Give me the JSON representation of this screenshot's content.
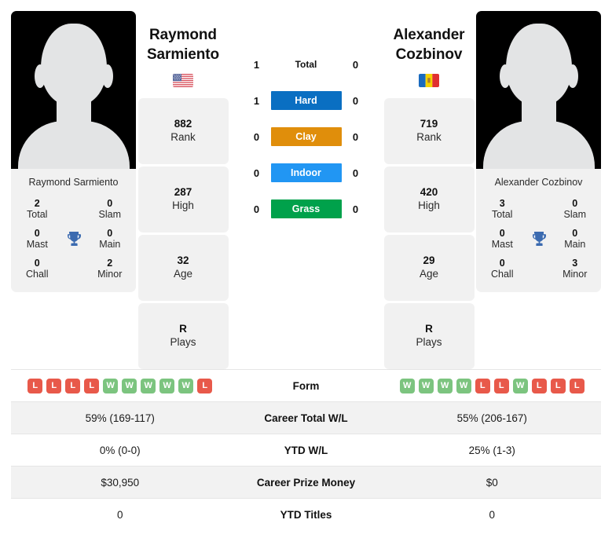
{
  "colors": {
    "win": "#7cc47f",
    "loss": "#e8594a",
    "hard": "#0a6fc2",
    "clay": "#e08e0b",
    "indoor": "#2196f3",
    "grass": "#00a14b",
    "trophy": "#3c6bb0",
    "card_bg": "#f1f1f1",
    "row_shade": "#f2f2f2"
  },
  "players": {
    "left": {
      "first_name": "Raymond",
      "last_name": "Sarmiento",
      "full_name": "Raymond Sarmiento",
      "country": "United States",
      "flag": "us-flag-icon",
      "avatar": "player-silhouette-avatar",
      "stats": [
        {
          "value": "882",
          "label": "Rank"
        },
        {
          "value": "287",
          "label": "High"
        },
        {
          "value": "32",
          "label": "Age"
        },
        {
          "value": "R",
          "label": "Plays"
        }
      ],
      "titles": [
        {
          "value": "2",
          "label": "Total"
        },
        {
          "value": "0",
          "label": "Slam"
        },
        {
          "value": "0",
          "label": "Mast"
        },
        {
          "value": "0",
          "label": "Main"
        },
        {
          "value": "0",
          "label": "Chall"
        },
        {
          "value": "2",
          "label": "Minor"
        }
      ],
      "form": [
        "L",
        "L",
        "L",
        "L",
        "W",
        "W",
        "W",
        "W",
        "W",
        "L"
      ],
      "career_total_wl": "59% (169-117)",
      "ytd_wl": "0% (0-0)",
      "career_prize_money": "$30,950",
      "ytd_titles": "0"
    },
    "right": {
      "first_name": "Alexander",
      "last_name": "Cozbinov",
      "full_name": "Alexander Cozbinov",
      "country": "Moldova",
      "flag": "md-flag-icon",
      "avatar": "player-silhouette-avatar",
      "stats": [
        {
          "value": "719",
          "label": "Rank"
        },
        {
          "value": "420",
          "label": "High"
        },
        {
          "value": "29",
          "label": "Age"
        },
        {
          "value": "R",
          "label": "Plays"
        }
      ],
      "titles": [
        {
          "value": "3",
          "label": "Total"
        },
        {
          "value": "0",
          "label": "Slam"
        },
        {
          "value": "0",
          "label": "Mast"
        },
        {
          "value": "0",
          "label": "Main"
        },
        {
          "value": "0",
          "label": "Chall"
        },
        {
          "value": "3",
          "label": "Minor"
        }
      ],
      "form": [
        "W",
        "W",
        "W",
        "W",
        "L",
        "L",
        "W",
        "L",
        "L",
        "L"
      ],
      "career_total_wl": "55% (206-167)",
      "ytd_wl": "25% (1-3)",
      "career_prize_money": "$0",
      "ytd_titles": "0"
    }
  },
  "h2h": [
    {
      "surface": "Total",
      "left": "1",
      "right": "0",
      "badge": false
    },
    {
      "surface": "Hard",
      "left": "1",
      "right": "0",
      "badge": true
    },
    {
      "surface": "Clay",
      "left": "0",
      "right": "0",
      "badge": true
    },
    {
      "surface": "Indoor",
      "left": "0",
      "right": "0",
      "badge": true
    },
    {
      "surface": "Grass",
      "left": "0",
      "right": "0",
      "badge": true
    }
  ],
  "table": {
    "rows": [
      {
        "label": "Form",
        "type": "form",
        "left": "",
        "right": ""
      },
      {
        "label": "Career Total W/L",
        "type": "text",
        "left": "59% (169-117)",
        "right": "55% (206-167)"
      },
      {
        "label": "YTD W/L",
        "type": "text",
        "left": "0% (0-0)",
        "right": "25% (1-3)"
      },
      {
        "label": "Career Prize Money",
        "type": "text",
        "left": "$30,950",
        "right": "$0"
      },
      {
        "label": "YTD Titles",
        "type": "text",
        "left": "0",
        "right": "0"
      }
    ]
  }
}
